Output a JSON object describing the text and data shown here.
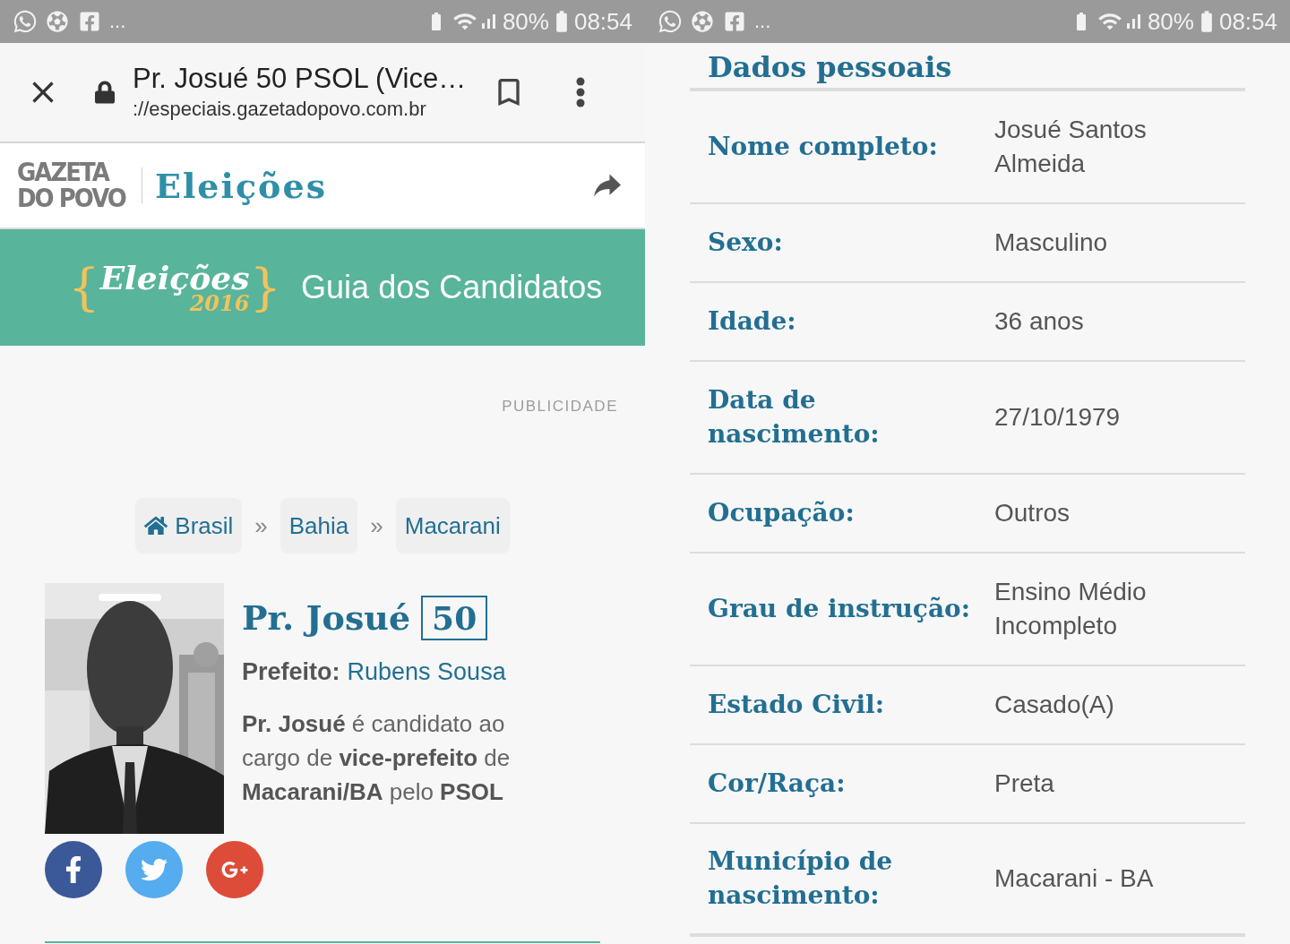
{
  "screens": [
    {
      "status_bar": {
        "more": "...",
        "battery": "80%",
        "time": "08:54"
      },
      "browser": {
        "title": "Pr. Josué 50 PSOL (Vice…",
        "url": "://especiais.gazetadopovo.com.br"
      },
      "site_header": {
        "logo_top": "GAZETA",
        "logo_bottom": "DO POVO",
        "section": "Eleições"
      },
      "banner": {
        "logo_open": "{",
        "logo_close": "}",
        "logo_word": "Eleições",
        "logo_year": "2016",
        "title": "Guia dos Candidatos"
      },
      "ad_label": "PUBLICIDADE",
      "breadcrumbs": [
        {
          "label": "Brasil",
          "kind": "home"
        },
        {
          "label": "Bahia",
          "kind": "plain"
        },
        {
          "label": "Macarani",
          "kind": "plain"
        }
      ],
      "breadcrumb_separator": "»",
      "candidate": {
        "name": "Pr. Josué",
        "number": "50",
        "mayor_label": "Prefeito:",
        "mayor_name": "Rubens Sousa",
        "description": "**Pr. Josué** é candidato ao cargo de **vice-prefeito** de **Macarani/BA** pelo **PSOL**"
      },
      "share": [
        {
          "kind": "facebook",
          "color": "#3b5998"
        },
        {
          "kind": "twitter",
          "color": "#55acee"
        },
        {
          "kind": "google",
          "color": "#dd4b39"
        }
      ]
    },
    {
      "status_bar": {
        "more": "...",
        "battery": "80%",
        "time": "08:54"
      },
      "section_title": "Dados pessoais",
      "rows": [
        {
          "label": "Nome completo:",
          "value": "Josué Santos Almeida"
        },
        {
          "label": "Sexo:",
          "value": "Masculino"
        },
        {
          "label": "Idade:",
          "value": "36 anos"
        },
        {
          "label": "Data de nascimento:",
          "value": "27/10/1979"
        },
        {
          "label": "Ocupação:",
          "value": "Outros"
        },
        {
          "label": "Grau de instrução:",
          "value": "Ensino Médio Incompleto"
        },
        {
          "label": "Estado Civil:",
          "value": "Casado(A)"
        },
        {
          "label": "Cor/Raça:",
          "value": "Preta"
        },
        {
          "label": "Município de nascimento:",
          "value": "Macarani - BA"
        }
      ]
    }
  ]
}
